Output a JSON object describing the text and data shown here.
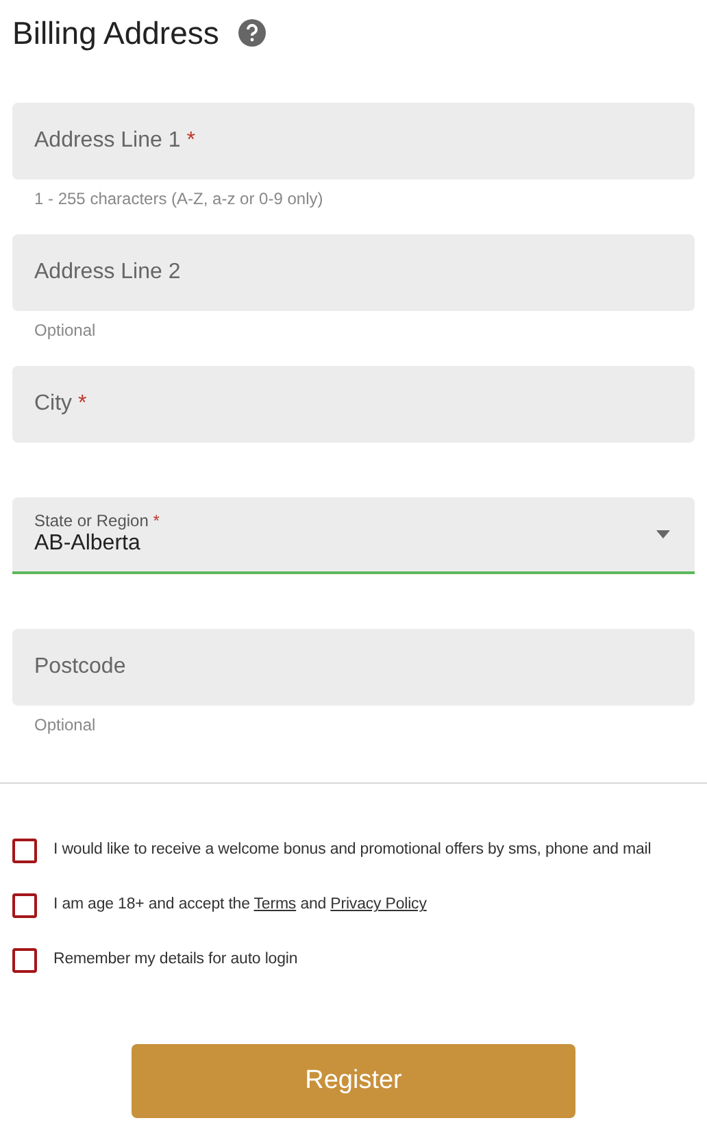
{
  "title": "Billing Address",
  "fields": [
    {
      "kind": "text",
      "label": "Address Line 1",
      "required_mark": "*",
      "hint": "1 - 255 characters (A-Z, a-z or 0-9 only)"
    },
    {
      "kind": "text",
      "label": "Address Line 2",
      "hint": "Optional"
    },
    {
      "kind": "text",
      "label": "City",
      "required_mark": "*"
    },
    {
      "kind": "select",
      "label": "State or Region",
      "required_mark": "*",
      "value": "AB-Alberta",
      "valid": true
    },
    {
      "kind": "text",
      "label": "Postcode",
      "hint": "Optional"
    }
  ],
  "checkboxes": [
    {
      "checked": false,
      "parts": [
        {
          "kind": "text",
          "text": "I would like to receive a welcome bonus and promotional offers by sms, phone and mail"
        }
      ]
    },
    {
      "checked": false,
      "parts": [
        {
          "kind": "text",
          "text": "I am age 18+ and accept the "
        },
        {
          "kind": "link",
          "text": "Terms"
        },
        {
          "kind": "text",
          "text": " and "
        },
        {
          "kind": "link",
          "text": "Privacy Policy"
        }
      ]
    },
    {
      "checked": false,
      "parts": [
        {
          "kind": "text",
          "text": "Remember my details for auto login"
        }
      ]
    }
  ],
  "button": "Register"
}
